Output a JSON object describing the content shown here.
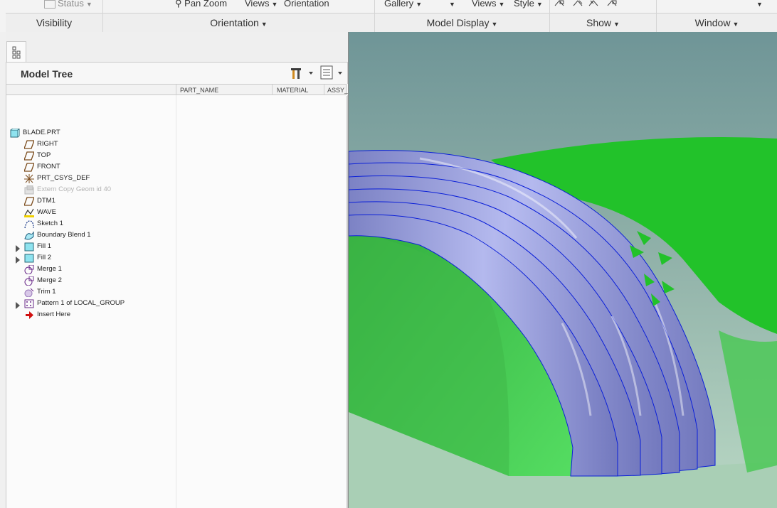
{
  "ribbon": {
    "top_items": {
      "status": "Status",
      "pan_zoom": "Pan Zoom",
      "views_1": "Views",
      "orientation": "Orientation",
      "gallery": "Gallery",
      "views_2": "Views",
      "style": "Style"
    },
    "groups": {
      "visibility": "Visibility",
      "orientation": "Orientation",
      "model_display": "Model Display",
      "show": "Show",
      "window": "Window"
    }
  },
  "model_tree": {
    "title": "Model Tree",
    "columns": [
      "PART_NAME",
      "MATERIAL",
      "ASSY_"
    ],
    "nodes": [
      {
        "label": "BLADE.PRT",
        "icon": "part-icon"
      },
      {
        "label": "RIGHT",
        "icon": "datum-plane-icon"
      },
      {
        "label": "TOP",
        "icon": "datum-plane-icon"
      },
      {
        "label": "FRONT",
        "icon": "datum-plane-icon"
      },
      {
        "label": "PRT_CSYS_DEF",
        "icon": "csys-icon"
      },
      {
        "label": "Extern Copy Geom id 40",
        "icon": "copy-geom-icon"
      },
      {
        "label": "DTM1",
        "icon": "datum-plane-icon"
      },
      {
        "label": "WAVE",
        "icon": "curve-icon"
      },
      {
        "label": "Sketch 1",
        "icon": "sketch-icon"
      },
      {
        "label": "Boundary Blend 1",
        "icon": "boundary-blend-icon"
      },
      {
        "label": "Fill 1",
        "icon": "fill-icon"
      },
      {
        "label": "Fill 2",
        "icon": "fill-icon"
      },
      {
        "label": "Merge 1",
        "icon": "merge-icon"
      },
      {
        "label": "Merge 2",
        "icon": "merge-icon"
      },
      {
        "label": "Trim 1",
        "icon": "trim-icon"
      },
      {
        "label": "Pattern 1 of LOCAL_GROUP",
        "icon": "pattern-icon"
      },
      {
        "label": "Insert Here",
        "icon": "insert-arrow-icon"
      }
    ]
  },
  "colors": {
    "viewport_bg_top": "#75979a",
    "surface_green": "#22c22a",
    "blade_blue": "#8d92d4",
    "edge_blue": "#0a1fd8",
    "insert_red": "#d01010"
  }
}
